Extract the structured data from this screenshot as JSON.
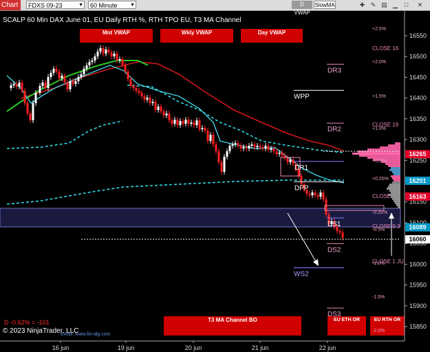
{
  "toolbar": {
    "tab_label": "Chart",
    "instrument": "FDXS 09-23",
    "interval": "60 Minute",
    "btn_dvwap": "D VWAP",
    "btn_slowma": "SlowMA"
  },
  "chart": {
    "title": "SCALP 60 Min DAX June 01, EU Daily RTH %, RTH TPO EU, T3 MA Channel",
    "footer_stats": "D -0.62% = -101",
    "copyright": "© 2023 NinjaTrader, LLC",
    "watermark": "Email: www.fin-alg.com",
    "buttons": {
      "mnt_vwap": "Mnt VWAP",
      "wkly_vwap": "Wkly VWAP",
      "day_vwap": "Day VWAP",
      "t3_channel": "T3 MA Channel BO",
      "eu_eth": "EU ETH OR",
      "eu_rth": "EU RTH OR"
    },
    "colors": {
      "background": "#000000",
      "up_candle": "#ffffff",
      "down_candle": "#ff2020",
      "red_button": "#d00000",
      "cyan": "#00c8d8",
      "pink_label": "#e888b8"
    },
    "levels": [
      {
        "label": "DR3",
        "price": 16465
      },
      {
        "label": "WPP",
        "price": 16402
      },
      {
        "label": "DR2",
        "price": 16323
      },
      {
        "label": "DR1",
        "price": 16231
      },
      {
        "label": "DPP",
        "price": 16182
      },
      {
        "label": "DS1",
        "price": 16095
      },
      {
        "label": "DS2",
        "price": 16033
      },
      {
        "label": "WS2",
        "price": 15975
      },
      {
        "label": "DS3",
        "price": 15878
      }
    ],
    "pct_labels": [
      "+2.5%",
      "+2.0%",
      "+1.5%",
      "+1.0%",
      "+0.5%",
      "+0.25%",
      "-0.25%",
      "-0.5%",
      "-1.0%",
      "-1.5%",
      "-2.0%"
    ],
    "right_labels": {
      "close16": "CLOSE 16",
      "close19": "CLOSE 19",
      "close_short": "CLOSE",
      "close93": "CLOSE 9.3",
      "close1j": "CLOSE 1 JU"
    },
    "price_badges": [
      {
        "value": "16265",
        "price": 16265,
        "color": "#e0002a"
      },
      {
        "value": "16201",
        "price": 16201,
        "color": "#0098c8"
      },
      {
        "value": "16163",
        "price": 16163,
        "color": "#e0002a"
      },
      {
        "value": "16089",
        "price": 16089,
        "color": "#0098c8"
      },
      {
        "value": "16060",
        "price": 16060,
        "color": "#ffffff"
      }
    ],
    "y_axis": {
      "min": 15825,
      "max": 16580,
      "ticks": [
        "16550",
        "16500",
        "16450",
        "16400",
        "16350",
        "16300",
        "16250",
        "16200",
        "16150",
        "16100",
        "16050",
        "16000",
        "15950",
        "15900",
        "15850"
      ]
    },
    "x_axis": {
      "ticks": [
        "16 jun",
        "19 jun",
        "20 jun",
        "21 jun",
        "22 jun"
      ]
    }
  }
}
